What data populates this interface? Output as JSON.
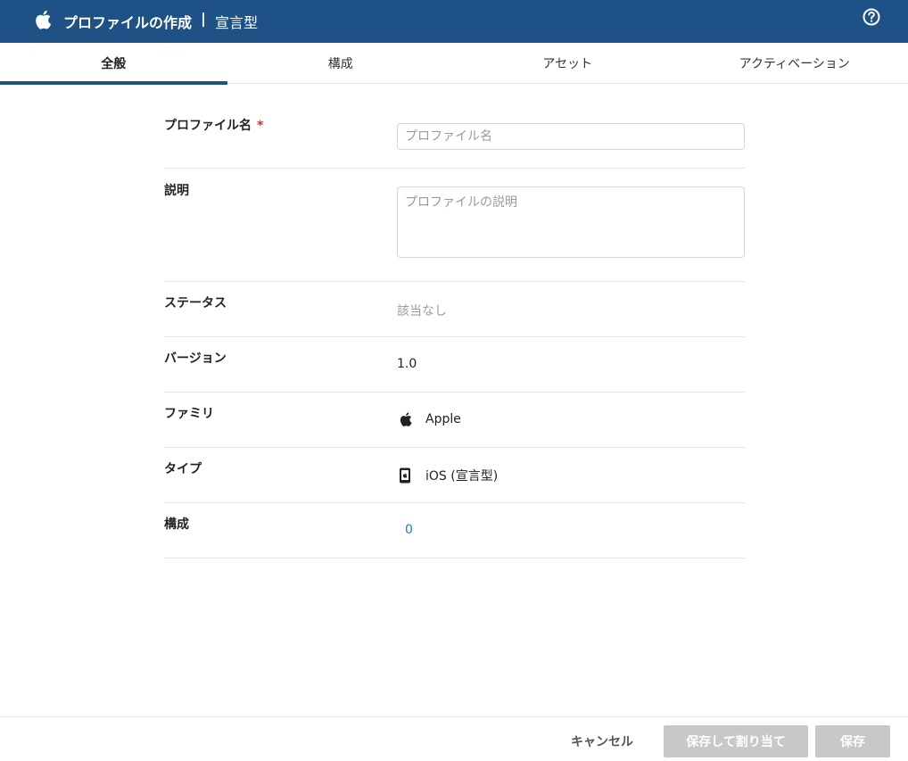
{
  "header": {
    "icon": "apple-icon",
    "title": "プロファイルの作成",
    "separator": "|",
    "subtitle": "宣言型",
    "help_icon": "help-circle-icon",
    "color": "#1e5185"
  },
  "tabs": [
    {
      "label": "全般",
      "active": true
    },
    {
      "label": "構成",
      "active": false
    },
    {
      "label": "アセット",
      "active": false
    },
    {
      "label": "アクティベーション",
      "active": false
    }
  ],
  "form": {
    "profile_name": {
      "label": "プロファイル名",
      "required_mark": "*",
      "value": "",
      "placeholder": "プロファイル名"
    },
    "description": {
      "label": "説明",
      "value": "",
      "placeholder": "プロファイルの説明"
    },
    "status": {
      "label": "ステータス",
      "value": "該当なし"
    },
    "version": {
      "label": "バージョン",
      "value": "1.0"
    },
    "family": {
      "label": "ファミリ",
      "value": "Apple",
      "icon": "apple-icon"
    },
    "type": {
      "label": "タイプ",
      "value": "iOS (宣言型)",
      "icon": "ios-device-icon"
    },
    "configuration": {
      "label": "構成",
      "value": "0"
    }
  },
  "footer": {
    "cancel_label": "キャンセル",
    "save_assign_label": "保存して割り当て",
    "save_label": "保存"
  }
}
